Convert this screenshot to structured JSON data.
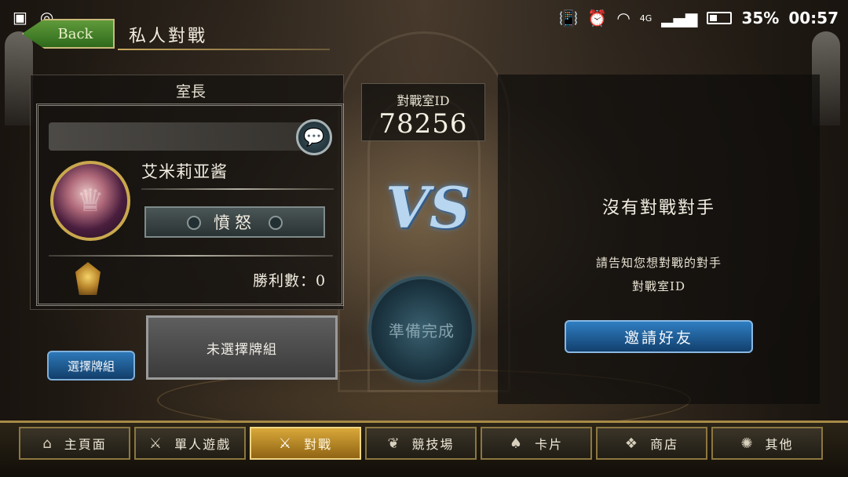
{
  "status_bar": {
    "network": "4G",
    "battery_level": 0.35,
    "battery_text": "35%",
    "time": "00:57"
  },
  "header": {
    "back_label": "Back",
    "title": "私人對戰"
  },
  "host": {
    "label": "室長",
    "player_name": "艾米莉亚酱",
    "emotion_label": "憤怒",
    "wins_text": "勝利數：0"
  },
  "deck": {
    "select_label": "選擇牌組",
    "slot_text": "未選擇牌組"
  },
  "room": {
    "label": "對戰室ID",
    "id": "78256"
  },
  "center": {
    "vs_text": "VS",
    "ready_label": "準備完成"
  },
  "opponent": {
    "title": "沒有對戰對手",
    "hint_line1": "請告知您想對戰的對手",
    "hint_line2": "對戰室ID",
    "invite_label": "邀請好友"
  },
  "nav": {
    "items": [
      {
        "label": "主頁面",
        "icon": "home-icon"
      },
      {
        "label": "單人遊戲",
        "icon": "sword-shield-icon"
      },
      {
        "label": "對戰",
        "icon": "crossed-swords-icon"
      },
      {
        "label": "競技場",
        "icon": "laurel-icon"
      },
      {
        "label": "卡片",
        "icon": "cards-icon"
      },
      {
        "label": "商店",
        "icon": "shop-icon"
      },
      {
        "label": "其他",
        "icon": "more-icon"
      }
    ],
    "active_index": 2
  },
  "colors": {
    "accent_gold": "#c9a84e",
    "button_blue": "#2f7ec2",
    "active_tab": "#d9a83a"
  }
}
